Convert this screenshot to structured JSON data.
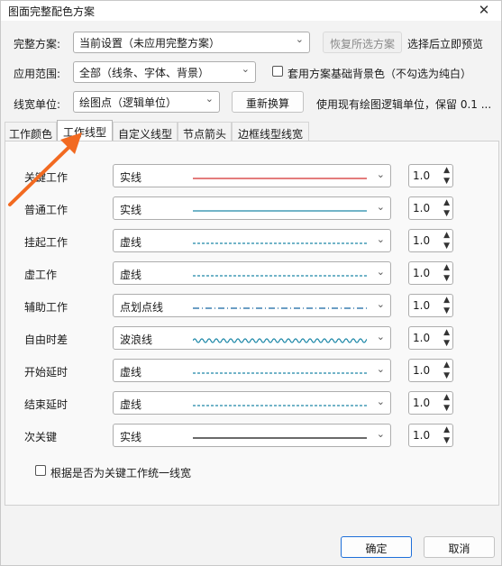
{
  "window": {
    "title": "图面完整配色方案",
    "close_glyph": "✕"
  },
  "scheme": {
    "label": "完整方案:",
    "value": "当前设置（未应用完整方案）",
    "restore_button": "恢复所选方案",
    "hint": "选择后立即预览"
  },
  "scope": {
    "label": "应用范围:",
    "value": "全部（线条、字体、背景）",
    "bg_checkbox_label": "套用方案基础背景色（不勾选为纯白）"
  },
  "unit": {
    "label": "线宽单位:",
    "value": "绘图点（逻辑单位）",
    "convert_button": "重新换算",
    "hint": "使用现有绘图逻辑单位，保留 0.1 ..."
  },
  "tabs": [
    {
      "label": "工作颜色"
    },
    {
      "label": "工作线型"
    },
    {
      "label": "自定义线型"
    },
    {
      "label": "节点箭头"
    },
    {
      "label": "边框线型线宽"
    }
  ],
  "active_tab": "工作线型",
  "rows": [
    {
      "label": "关键工作",
      "style": "实线",
      "preview": "solid",
      "color": "#d32f2f",
      "width": "1.0"
    },
    {
      "label": "普通工作",
      "style": "实线",
      "preview": "solid",
      "color": "#1e88a8",
      "width": "1.0"
    },
    {
      "label": "挂起工作",
      "style": "虚线",
      "preview": "dashed",
      "color": "#1e88a8",
      "width": "1.0"
    },
    {
      "label": "虚工作",
      "style": "虚线",
      "preview": "dashed",
      "color": "#1e88a8",
      "width": "1.0"
    },
    {
      "label": "辅助工作",
      "style": "点划点线",
      "preview": "dashdot",
      "color": "#1565a0",
      "width": "1.0"
    },
    {
      "label": "自由时差",
      "style": "波浪线",
      "preview": "wave",
      "color": "#1e88a8",
      "width": "1.0"
    },
    {
      "label": "开始延时",
      "style": "虚线",
      "preview": "dashed",
      "color": "#1e88a8",
      "width": "1.0"
    },
    {
      "label": "结束延时",
      "style": "虚线",
      "preview": "dashed",
      "color": "#1e88a8",
      "width": "1.0"
    },
    {
      "label": "次关键",
      "style": "实线",
      "preview": "solid",
      "color": "#111111",
      "width": "1.0"
    }
  ],
  "uniform_width_checkbox": "根据是否为关键工作统一线宽",
  "footer": {
    "ok": "确定",
    "cancel": "取消"
  },
  "colors": {
    "accent": "#1e6fd9",
    "annotation_arrow": "#f26a21"
  }
}
